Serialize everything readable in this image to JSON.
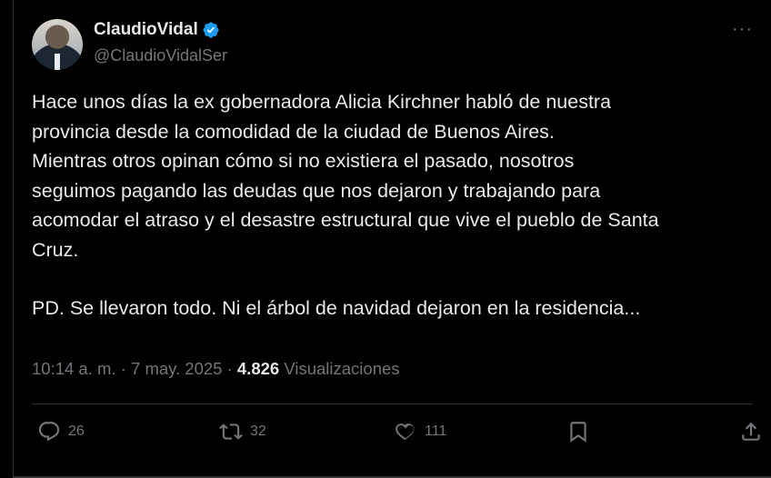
{
  "author": {
    "display_name": "ClaudioVidal",
    "handle": "@ClaudioVidalSer",
    "verified": true
  },
  "tweet": {
    "paragraph_1": "Hace unos días la ex gobernadora Alicia Kirchner habló de nuestra\nprovincia desde la comodidad de la ciudad de Buenos Aires.\nMientras otros opinan cómo si no existiera el pasado, nosotros\nseguimos pagando las deudas que nos dejaron y trabajando para\nacomodar el atraso y el desastre estructural que vive el pueblo de Santa\nCruz.",
    "paragraph_2": "PD. Se llevaron todo. Ni el árbol de navidad dejaron en la residencia..."
  },
  "meta": {
    "time": "10:14 a. m.",
    "separator": "·",
    "date": "7 may. 2025",
    "views_count": "4.826",
    "views_label": "Visualizaciones"
  },
  "actions": {
    "replies": "26",
    "reposts": "32",
    "likes": "111"
  },
  "colors": {
    "background": "#000000",
    "text": "#e7e9ea",
    "muted": "#71767b",
    "verified_blue": "#1d9bf0",
    "divider": "#2f3336"
  }
}
